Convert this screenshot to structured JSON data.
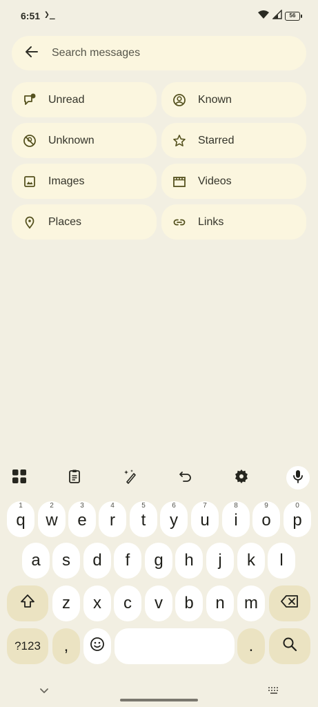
{
  "status": {
    "time": "6:51",
    "terminal": "❯_",
    "battery": "56"
  },
  "search": {
    "placeholder": "Search messages",
    "value": ""
  },
  "filters": [
    {
      "label": "Unread",
      "icon": "unread-chat-icon"
    },
    {
      "label": "Known",
      "icon": "known-contact-icon"
    },
    {
      "label": "Unknown",
      "icon": "unknown-contact-icon"
    },
    {
      "label": "Starred",
      "icon": "star-icon"
    },
    {
      "label": "Images",
      "icon": "image-icon"
    },
    {
      "label": "Videos",
      "icon": "video-icon"
    },
    {
      "label": "Places",
      "icon": "location-pin-icon"
    },
    {
      "label": "Links",
      "icon": "link-icon"
    }
  ],
  "keyboard": {
    "row1": [
      {
        "k": "q",
        "h": "1"
      },
      {
        "k": "w",
        "h": "2"
      },
      {
        "k": "e",
        "h": "3"
      },
      {
        "k": "r",
        "h": "4"
      },
      {
        "k": "t",
        "h": "5"
      },
      {
        "k": "y",
        "h": "6"
      },
      {
        "k": "u",
        "h": "7"
      },
      {
        "k": "i",
        "h": "8"
      },
      {
        "k": "o",
        "h": "9"
      },
      {
        "k": "p",
        "h": "0"
      }
    ],
    "row2": [
      "a",
      "s",
      "d",
      "f",
      "g",
      "h",
      "j",
      "k",
      "l"
    ],
    "row3": [
      "z",
      "x",
      "c",
      "v",
      "b",
      "n",
      "m"
    ],
    "symbols_label": "?123",
    "comma": ",",
    "period": ".",
    "accent": "#ebe3c2"
  }
}
